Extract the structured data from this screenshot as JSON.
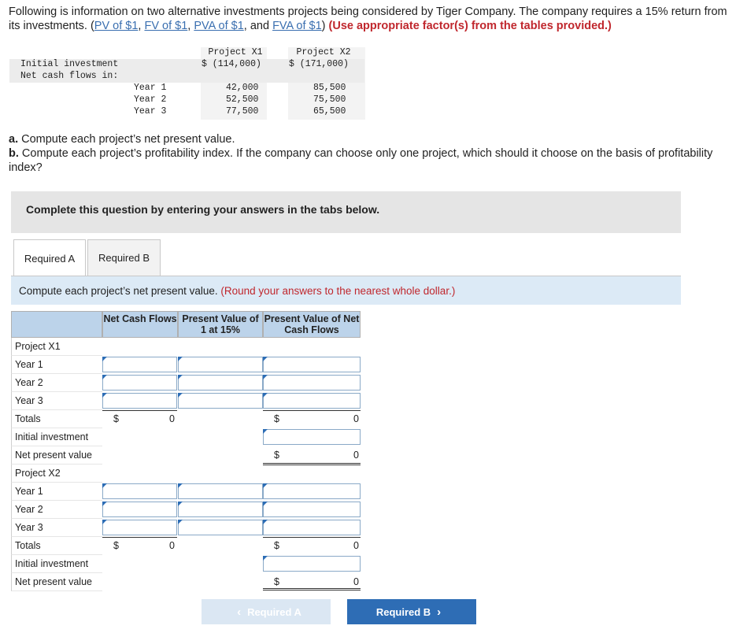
{
  "intro": {
    "text1": "Following is information on two alternative investments projects being considered by Tiger Company. The company requires a 15% return from its investments. (",
    "link_pv": "PV of $1",
    "link_fv": "FV of $1",
    "link_pva": "PVA of $1",
    "link_and": "and",
    "link_fva": "FVA of $1",
    "instruction": "(Use appropriate factor(s) from the tables provided.)"
  },
  "data_table": {
    "col_x1": "Project X1",
    "col_x2": "Project X2",
    "initial_label": "Initial investment",
    "initial_x1": "$ (114,000)",
    "initial_x2": "$ (171,000)",
    "ncf_label": "Net cash flows in:",
    "years": [
      {
        "label": "Year 1",
        "x1": "42,000",
        "x2": "85,500"
      },
      {
        "label": "Year 2",
        "x1": "52,500",
        "x2": "75,500"
      },
      {
        "label": "Year 3",
        "x1": "77,500",
        "x2": "65,500"
      }
    ]
  },
  "questions": {
    "a_prefix": "a.",
    "a_text": " Compute each project’s net present value.",
    "b_prefix": "b.",
    "b_text": " Compute each project’s profitability index. If the company can choose only one project, which should it choose on the basis of profitability index?"
  },
  "instruction_box": "Complete this question by entering your answers in the tabs below.",
  "tabs": [
    {
      "label": "Required A",
      "active": true
    },
    {
      "label": "Required B",
      "active": false
    }
  ],
  "compute_bar": {
    "text": "Compute each project’s net present value. ",
    "note": "(Round your answers to the nearest whole dollar.)"
  },
  "grid": {
    "headers": {
      "ncf": "Net Cash Flows",
      "pv1": "Present Value of 1 at 15%",
      "pvn": "Present Value of Net Cash Flows"
    },
    "rows": [
      "Project X1",
      "Year 1",
      "Year 2",
      "Year 3",
      "Totals",
      "Initial investment",
      "Net present value",
      "Project X2",
      "Year 1",
      "Year 2",
      "Year 3",
      "Totals",
      "Initial investment",
      "Net present value"
    ],
    "dollar": "$",
    "totals_ncf_x1": "0",
    "totals_pv_x1": "0",
    "npv_x1": "0",
    "totals_ncf_x2": "0",
    "totals_pv_x2": "0",
    "npv_x2": "0"
  },
  "buttons": {
    "prev_label": "Required A",
    "next_label": "Required B",
    "prev_chevron": "‹",
    "next_chevron": "›"
  },
  "colors": {
    "link": "#3a6fb0",
    "accent_red": "#c0272d",
    "header_blue": "#bcd3ea",
    "next_button": "#2e6db5",
    "prev_button_disabled": "#dbe7f3"
  }
}
